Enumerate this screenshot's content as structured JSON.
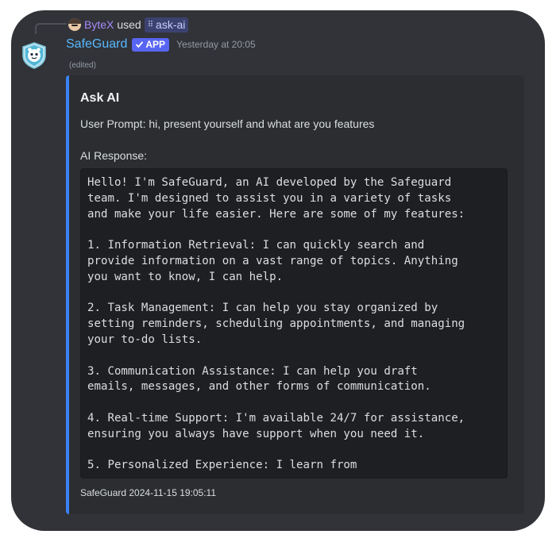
{
  "reply": {
    "user": "ByteX",
    "used_text": "used",
    "command": "ask-ai"
  },
  "message": {
    "author": "SafeGuard",
    "badge": "APP",
    "timestamp": "Yesterday at 20:05",
    "edited": "(edited)"
  },
  "embed": {
    "title": "Ask AI",
    "prompt": "User Prompt: hi, present yourself and what are you features",
    "response_label": "AI Response:",
    "response_code": "Hello! I'm SafeGuard, an AI developed by the Safeguard\nteam. I'm designed to assist you in a variety of tasks\nand make your life easier. Here are some of my features:\n\n1. Information Retrieval: I can quickly search and\nprovide information on a vast range of topics. Anything\nyou want to know, I can help.\n\n2. Task Management: I can help you stay organized by\nsetting reminders, scheduling appointments, and managing\nyour to-do lists.\n\n3. Communication Assistance: I can help you draft\nemails, messages, and other forms of communication.\n\n4. Real-time Support: I'm available 24/7 for assistance,\nensuring you always have support when you need it.\n\n5. Personalized Experience: I learn from",
    "footer": "SafeGuard 2024-11-15 19:05:11",
    "accent_color": "#3b82f6"
  },
  "colors": {
    "background": "#313338",
    "embed_bg": "#2b2d31",
    "code_bg": "#1e1f22",
    "username": "#58b9ff",
    "app_badge": "#5865f2",
    "reply_user": "#a78bfa"
  }
}
